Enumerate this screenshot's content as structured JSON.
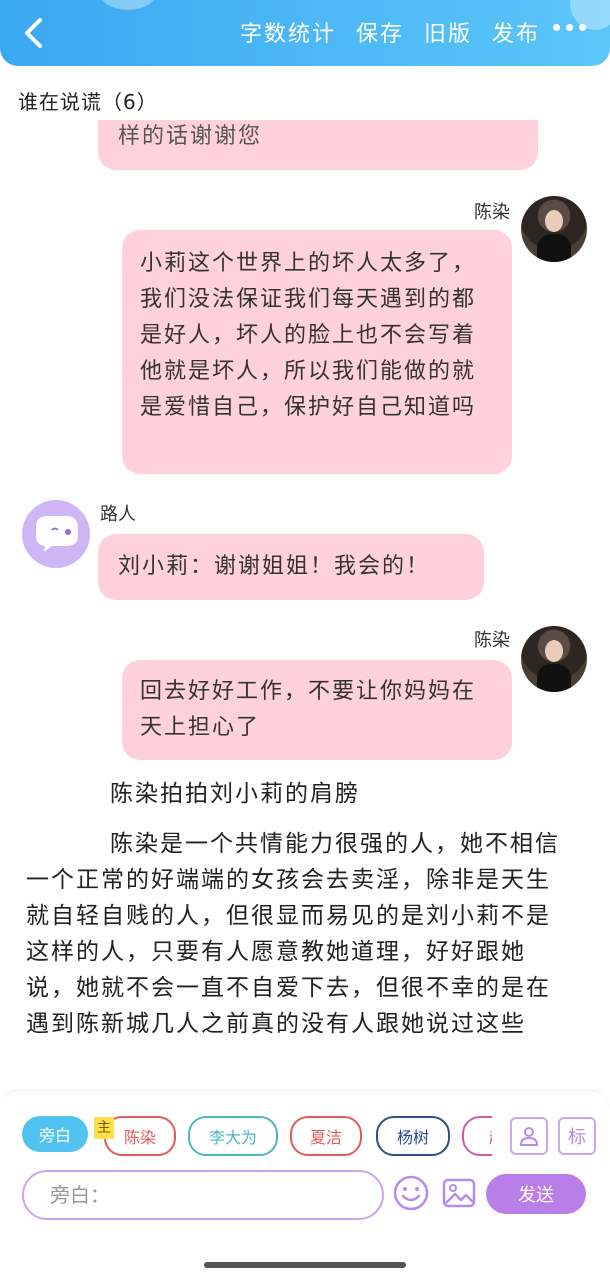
{
  "topbar": {
    "actions": [
      "字数统计",
      "保存",
      "旧版",
      "发布"
    ]
  },
  "title": "谁在说谎（6）",
  "messages": {
    "partial_text": "样的话谢谢您",
    "m1": {
      "name": "陈染",
      "text": "小莉这个世界上的坏人太多了，我们没法保证我们每天遇到的都是好人，坏人的脸上也不会写着他就是坏人，所以我们能做的就是爱惜自己，保护好自己知道吗"
    },
    "m2": {
      "name": "路人",
      "text": "刘小莉：谢谢姐姐！我会的！"
    },
    "m3": {
      "name": "陈染",
      "text": "回去好好工作，不要让你妈妈在天上担心了"
    }
  },
  "narration": {
    "line1": "陈染拍拍刘小莉的肩膀",
    "para": "陈染是一个共情能力很强的人，她不相信一个正常的好端端的女孩会去卖淫，除非是天生就自轻自贱的人，但很显而易见的是刘小莉不是这样的人，只要有人愿意教她道理，好好跟她说，她就不会一直不自爱下去，但很不幸的是在遇到陈新城几人之前真的没有人跟她说过这些"
  },
  "bottom": {
    "chips": [
      "旁白",
      "陈染",
      "李大为",
      "夏洁",
      "杨树",
      "赵"
    ],
    "main_mark": "主",
    "side_buttons": [
      "标"
    ],
    "input_placeholder": "旁白：",
    "send_label": "发送"
  },
  "colors": {
    "topbar": "#3aa8f2",
    "bubble": "#ffd1dc",
    "accent": "#b97ee8"
  }
}
